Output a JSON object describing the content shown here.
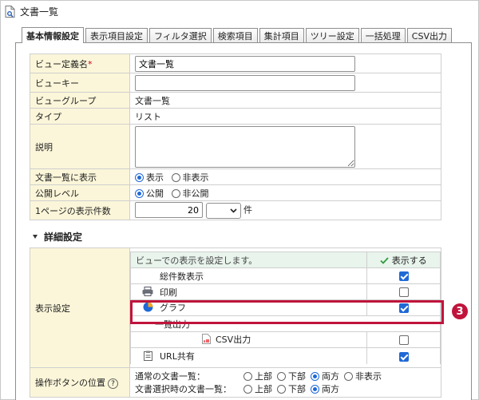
{
  "window": {
    "title": "文書一覧"
  },
  "tabs": [
    {
      "label": "基本情報設定",
      "active": true
    },
    {
      "label": "表示項目設定"
    },
    {
      "label": "フィルタ選択"
    },
    {
      "label": "検索項目"
    },
    {
      "label": "集計項目"
    },
    {
      "label": "ツリー設定"
    },
    {
      "label": "一括処理"
    },
    {
      "label": "CSV出力"
    }
  ],
  "form": {
    "view_name": {
      "label": "ビュー定義名",
      "required_mark": "*",
      "value": "文書一覧"
    },
    "view_key": {
      "label": "ビューキー",
      "value": ""
    },
    "view_group": {
      "label": "ビューグループ",
      "value": "文書一覧"
    },
    "type": {
      "label": "タイプ",
      "value": "リスト"
    },
    "description": {
      "label": "説明",
      "value": ""
    },
    "show_in_list": {
      "label": "文書一覧に表示",
      "options": [
        "表示",
        "非表示"
      ],
      "selected": "表示"
    },
    "public_level": {
      "label": "公開レベル",
      "options": [
        "公開",
        "非公開"
      ],
      "selected": "公開"
    },
    "per_page": {
      "label": "1ページの表示件数",
      "value": "20",
      "unit": "件"
    }
  },
  "detail_section": {
    "title": "詳細設定"
  },
  "display_settings": {
    "label": "表示設定",
    "header": "ビューでの表示を設定します。",
    "check_header": "表示する",
    "items": [
      {
        "label": "総件数表示",
        "icon": "",
        "checked": true
      },
      {
        "label": "印刷",
        "icon": "printer-icon",
        "checked": false
      },
      {
        "label": "グラフ",
        "icon": "pie-chart-icon",
        "checked": true
      },
      {
        "label": "一覧出力",
        "icon": "",
        "group": true
      },
      {
        "label": "CSV出力",
        "icon": "csv-file-icon",
        "checked": false
      },
      {
        "label": "URL共有",
        "icon": "clipboard-icon",
        "checked": true
      }
    ]
  },
  "button_position": {
    "label": "操作ボタンの位置",
    "help": "?",
    "rows": [
      {
        "label": "通常の文書一覧：",
        "options": [
          "上部",
          "下部",
          "両方",
          "非表示"
        ],
        "selected": "両方"
      },
      {
        "label": "文書選択時の文書一覧：",
        "options": [
          "上部",
          "下部",
          "両方"
        ],
        "selected": "両方"
      }
    ]
  },
  "annotation": {
    "number": "3"
  },
  "colors": {
    "label_bg": "#fbf6d9",
    "highlight": "#c0143c",
    "accent": "#1f69d6",
    "header_bg": "#e8f4ec"
  }
}
